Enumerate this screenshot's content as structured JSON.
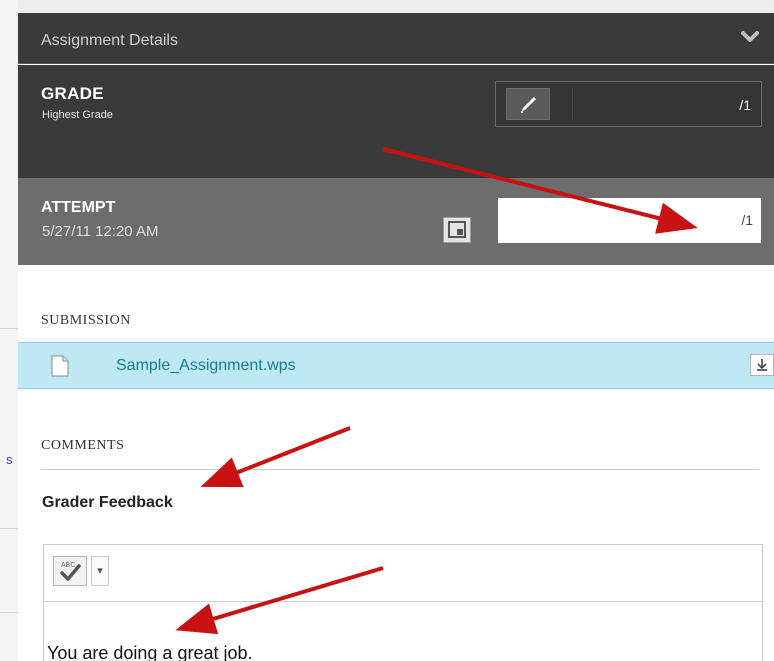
{
  "assignment_details": {
    "title": "Assignment Details",
    "collapse_icon": "chevron-down-icon"
  },
  "grade": {
    "title": "GRADE",
    "subtitle": "Highest Grade",
    "edit_icon": "pencil-icon",
    "max_points": "/1"
  },
  "attempt": {
    "title": "ATTEMPT",
    "date": "5/27/11 12:20 AM",
    "grade_value": "",
    "max_points": "/1",
    "icon": "attempt-panel-icon"
  },
  "submission": {
    "label": "SUBMISSION",
    "file_name": "Sample_Assignment.wps",
    "file_icon": "document-icon",
    "download_icon": "download-icon"
  },
  "comments": {
    "label": "COMMENTS",
    "feedback_heading": "Grader Feedback",
    "spellcheck_icon": "spellcheck-icon",
    "dropdown_icon": "dropdown-arrow-icon",
    "feedback_text": "You are doing a great job."
  },
  "colors": {
    "header_dark": "#3a3a3a",
    "attempt_gray": "#6d6d6d",
    "submission_row": "#bde8f4",
    "link": "#1a7e92",
    "annotation_arrow": "#c81212"
  }
}
